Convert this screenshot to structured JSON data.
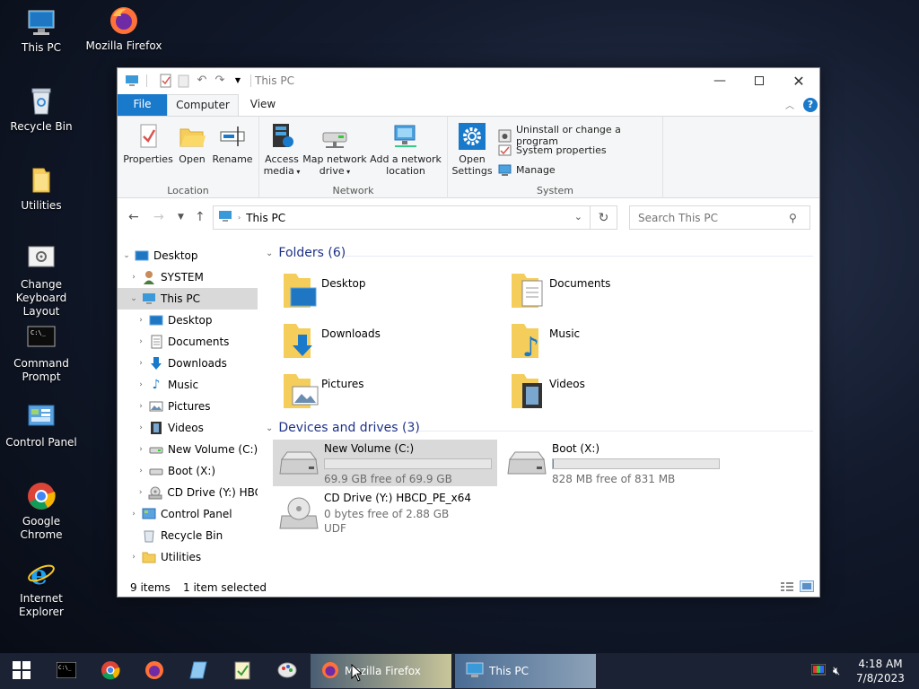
{
  "desktop": {
    "icons": [
      {
        "label": "This PC"
      },
      {
        "label": "Mozilla Firefox"
      },
      {
        "label": "Recycle Bin"
      },
      {
        "label": "Utilities"
      },
      {
        "label": "Change Keyboard Layout"
      },
      {
        "label": "Command Prompt"
      },
      {
        "label": "Control Panel"
      },
      {
        "label": "Google Chrome"
      },
      {
        "label": "Internet Explorer"
      }
    ]
  },
  "window": {
    "title": "This PC",
    "tabs": {
      "file": "File",
      "computer": "Computer",
      "view": "View"
    },
    "ribbon": {
      "location": {
        "name": "Location",
        "properties": "Properties",
        "open": "Open",
        "rename": "Rename"
      },
      "network": {
        "name": "Network",
        "access_media_1": "Access",
        "access_media_2": "media",
        "map_drive_1": "Map network",
        "map_drive_2": "drive",
        "add_location_1": "Add a network",
        "add_location_2": "location"
      },
      "system": {
        "name": "System",
        "open_settings_1": "Open",
        "open_settings_2": "Settings",
        "uninstall": "Uninstall or change a program",
        "system_properties": "System properties",
        "manage": "Manage"
      }
    },
    "address": {
      "path": "This PC",
      "search_placeholder": "Search This PC"
    },
    "nav_tree": [
      {
        "label": "Desktop"
      },
      {
        "label": "SYSTEM"
      },
      {
        "label": "This PC"
      },
      {
        "label": "Desktop"
      },
      {
        "label": "Documents"
      },
      {
        "label": "Downloads"
      },
      {
        "label": "Music"
      },
      {
        "label": "Pictures"
      },
      {
        "label": "Videos"
      },
      {
        "label": "New Volume (C:)"
      },
      {
        "label": "Boot (X:)"
      },
      {
        "label": "CD Drive (Y:) HBC"
      },
      {
        "label": "Control Panel"
      },
      {
        "label": "Recycle Bin"
      },
      {
        "label": "Utilities"
      }
    ],
    "folders_header": "Folders (6)",
    "folders": [
      {
        "name": "Desktop"
      },
      {
        "name": "Documents"
      },
      {
        "name": "Downloads"
      },
      {
        "name": "Music"
      },
      {
        "name": "Pictures"
      },
      {
        "name": "Videos"
      }
    ],
    "drives_header": "Devices and drives (3)",
    "drives": [
      {
        "name": "New Volume (C:)",
        "free": "69.9 GB free of 69.9 GB",
        "used_fraction": 0.0
      },
      {
        "name": "Boot (X:)",
        "free": "828 MB free of 831 MB",
        "used_fraction": 0.004
      },
      {
        "name": "CD Drive (Y:) HBCD_PE_x64",
        "free": "0 bytes free of 2.88 GB",
        "fs": "UDF"
      }
    ],
    "status": {
      "items": "9 items",
      "selected": "1 item selected"
    }
  },
  "taskbar": {
    "apps": [
      {
        "label": "Mozilla Firefox"
      },
      {
        "label": "This PC"
      }
    ],
    "clock": {
      "time": "4:18 AM",
      "date": "7/8/2023"
    }
  },
  "colors": {
    "accent": "#1979ca",
    "selection": "#d9d9d9",
    "header_blue": "#1e3287",
    "folder_yellow": "#f5cd5a"
  }
}
